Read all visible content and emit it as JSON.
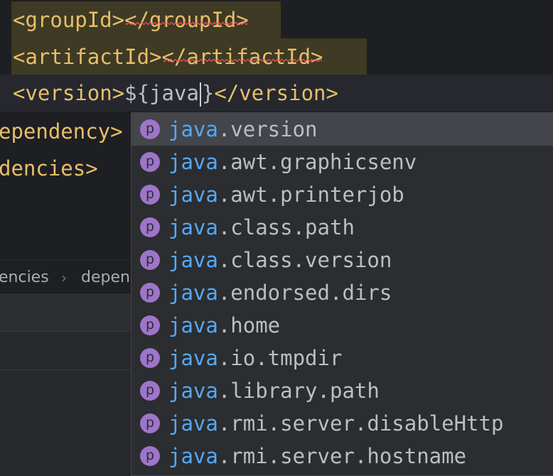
{
  "editor": {
    "lines": {
      "group_open": "<groupId>",
      "group_close": "</groupId>",
      "artifact_open": "<artifactId>",
      "artifact_close": "</artifactId>",
      "version_open": "<version>",
      "version_expr_prefix": "${",
      "version_expr_typed": "java",
      "version_expr_suffix": "}",
      "version_close": "</version>",
      "dependency_partial": "ependency>",
      "dependencies_partial": "dencies>"
    },
    "error_underline_color": "#f75464"
  },
  "breadcrumbs": {
    "items": [
      "encies",
      "depen"
    ]
  },
  "completion": {
    "icon_letter": "p",
    "icon_color": "#9e75c9",
    "match_color": "#56a8f5",
    "items": [
      {
        "match": "java",
        "rest": ".version"
      },
      {
        "match": "java",
        "rest": ".awt.graphicsenv"
      },
      {
        "match": "java",
        "rest": ".awt.printerjob"
      },
      {
        "match": "java",
        "rest": ".class.path"
      },
      {
        "match": "java",
        "rest": ".class.version"
      },
      {
        "match": "java",
        "rest": ".endorsed.dirs"
      },
      {
        "match": "java",
        "rest": ".home"
      },
      {
        "match": "java",
        "rest": ".io.tmpdir"
      },
      {
        "match": "java",
        "rest": ".library.path"
      },
      {
        "match": "java",
        "rest": ".rmi.server.disableHttp"
      },
      {
        "match": "java",
        "rest": ".rmi.server.hostname"
      }
    ]
  }
}
